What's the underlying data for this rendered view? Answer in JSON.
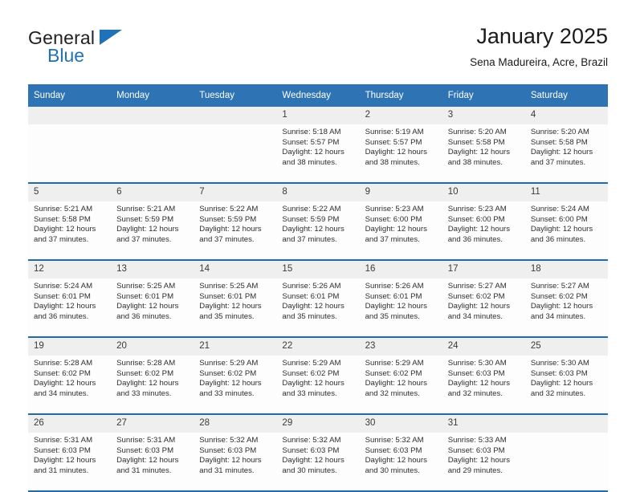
{
  "brand": {
    "name_top": "General",
    "name_bottom": "Blue",
    "triangle_icon": "triangle-icon",
    "color_dark": "#231f20",
    "color_blue": "#2072b8"
  },
  "header": {
    "title": "January 2025",
    "subtitle": "Sena Madureira, Acre, Brazil"
  },
  "theme": {
    "header_blue": "#2e74b5",
    "separator_blue": "#1f6cac",
    "date_band_gray": "#efefef",
    "cell_white": "#fdfdfd"
  },
  "calendar": {
    "weekdays": [
      "Sunday",
      "Monday",
      "Tuesday",
      "Wednesday",
      "Thursday",
      "Friday",
      "Saturday"
    ],
    "weeks": [
      [
        {
          "day": "",
          "sunrise": "",
          "sunset": "",
          "daylight": ""
        },
        {
          "day": "",
          "sunrise": "",
          "sunset": "",
          "daylight": ""
        },
        {
          "day": "",
          "sunrise": "",
          "sunset": "",
          "daylight": ""
        },
        {
          "day": "1",
          "sunrise": "Sunrise: 5:18 AM",
          "sunset": "Sunset: 5:57 PM",
          "daylight": "Daylight: 12 hours and 38 minutes."
        },
        {
          "day": "2",
          "sunrise": "Sunrise: 5:19 AM",
          "sunset": "Sunset: 5:57 PM",
          "daylight": "Daylight: 12 hours and 38 minutes."
        },
        {
          "day": "3",
          "sunrise": "Sunrise: 5:20 AM",
          "sunset": "Sunset: 5:58 PM",
          "daylight": "Daylight: 12 hours and 38 minutes."
        },
        {
          "day": "4",
          "sunrise": "Sunrise: 5:20 AM",
          "sunset": "Sunset: 5:58 PM",
          "daylight": "Daylight: 12 hours and 37 minutes."
        }
      ],
      [
        {
          "day": "5",
          "sunrise": "Sunrise: 5:21 AM",
          "sunset": "Sunset: 5:58 PM",
          "daylight": "Daylight: 12 hours and 37 minutes."
        },
        {
          "day": "6",
          "sunrise": "Sunrise: 5:21 AM",
          "sunset": "Sunset: 5:59 PM",
          "daylight": "Daylight: 12 hours and 37 minutes."
        },
        {
          "day": "7",
          "sunrise": "Sunrise: 5:22 AM",
          "sunset": "Sunset: 5:59 PM",
          "daylight": "Daylight: 12 hours and 37 minutes."
        },
        {
          "day": "8",
          "sunrise": "Sunrise: 5:22 AM",
          "sunset": "Sunset: 5:59 PM",
          "daylight": "Daylight: 12 hours and 37 minutes."
        },
        {
          "day": "9",
          "sunrise": "Sunrise: 5:23 AM",
          "sunset": "Sunset: 6:00 PM",
          "daylight": "Daylight: 12 hours and 37 minutes."
        },
        {
          "day": "10",
          "sunrise": "Sunrise: 5:23 AM",
          "sunset": "Sunset: 6:00 PM",
          "daylight": "Daylight: 12 hours and 36 minutes."
        },
        {
          "day": "11",
          "sunrise": "Sunrise: 5:24 AM",
          "sunset": "Sunset: 6:00 PM",
          "daylight": "Daylight: 12 hours and 36 minutes."
        }
      ],
      [
        {
          "day": "12",
          "sunrise": "Sunrise: 5:24 AM",
          "sunset": "Sunset: 6:01 PM",
          "daylight": "Daylight: 12 hours and 36 minutes."
        },
        {
          "day": "13",
          "sunrise": "Sunrise: 5:25 AM",
          "sunset": "Sunset: 6:01 PM",
          "daylight": "Daylight: 12 hours and 36 minutes."
        },
        {
          "day": "14",
          "sunrise": "Sunrise: 5:25 AM",
          "sunset": "Sunset: 6:01 PM",
          "daylight": "Daylight: 12 hours and 35 minutes."
        },
        {
          "day": "15",
          "sunrise": "Sunrise: 5:26 AM",
          "sunset": "Sunset: 6:01 PM",
          "daylight": "Daylight: 12 hours and 35 minutes."
        },
        {
          "day": "16",
          "sunrise": "Sunrise: 5:26 AM",
          "sunset": "Sunset: 6:01 PM",
          "daylight": "Daylight: 12 hours and 35 minutes."
        },
        {
          "day": "17",
          "sunrise": "Sunrise: 5:27 AM",
          "sunset": "Sunset: 6:02 PM",
          "daylight": "Daylight: 12 hours and 34 minutes."
        },
        {
          "day": "18",
          "sunrise": "Sunrise: 5:27 AM",
          "sunset": "Sunset: 6:02 PM",
          "daylight": "Daylight: 12 hours and 34 minutes."
        }
      ],
      [
        {
          "day": "19",
          "sunrise": "Sunrise: 5:28 AM",
          "sunset": "Sunset: 6:02 PM",
          "daylight": "Daylight: 12 hours and 34 minutes."
        },
        {
          "day": "20",
          "sunrise": "Sunrise: 5:28 AM",
          "sunset": "Sunset: 6:02 PM",
          "daylight": "Daylight: 12 hours and 33 minutes."
        },
        {
          "day": "21",
          "sunrise": "Sunrise: 5:29 AM",
          "sunset": "Sunset: 6:02 PM",
          "daylight": "Daylight: 12 hours and 33 minutes."
        },
        {
          "day": "22",
          "sunrise": "Sunrise: 5:29 AM",
          "sunset": "Sunset: 6:02 PM",
          "daylight": "Daylight: 12 hours and 33 minutes."
        },
        {
          "day": "23",
          "sunrise": "Sunrise: 5:29 AM",
          "sunset": "Sunset: 6:02 PM",
          "daylight": "Daylight: 12 hours and 32 minutes."
        },
        {
          "day": "24",
          "sunrise": "Sunrise: 5:30 AM",
          "sunset": "Sunset: 6:03 PM",
          "daylight": "Daylight: 12 hours and 32 minutes."
        },
        {
          "day": "25",
          "sunrise": "Sunrise: 5:30 AM",
          "sunset": "Sunset: 6:03 PM",
          "daylight": "Daylight: 12 hours and 32 minutes."
        }
      ],
      [
        {
          "day": "26",
          "sunrise": "Sunrise: 5:31 AM",
          "sunset": "Sunset: 6:03 PM",
          "daylight": "Daylight: 12 hours and 31 minutes."
        },
        {
          "day": "27",
          "sunrise": "Sunrise: 5:31 AM",
          "sunset": "Sunset: 6:03 PM",
          "daylight": "Daylight: 12 hours and 31 minutes."
        },
        {
          "day": "28",
          "sunrise": "Sunrise: 5:32 AM",
          "sunset": "Sunset: 6:03 PM",
          "daylight": "Daylight: 12 hours and 31 minutes."
        },
        {
          "day": "29",
          "sunrise": "Sunrise: 5:32 AM",
          "sunset": "Sunset: 6:03 PM",
          "daylight": "Daylight: 12 hours and 30 minutes."
        },
        {
          "day": "30",
          "sunrise": "Sunrise: 5:32 AM",
          "sunset": "Sunset: 6:03 PM",
          "daylight": "Daylight: 12 hours and 30 minutes."
        },
        {
          "day": "31",
          "sunrise": "Sunrise: 5:33 AM",
          "sunset": "Sunset: 6:03 PM",
          "daylight": "Daylight: 12 hours and 29 minutes."
        },
        {
          "day": "",
          "sunrise": "",
          "sunset": "",
          "daylight": ""
        }
      ]
    ]
  }
}
